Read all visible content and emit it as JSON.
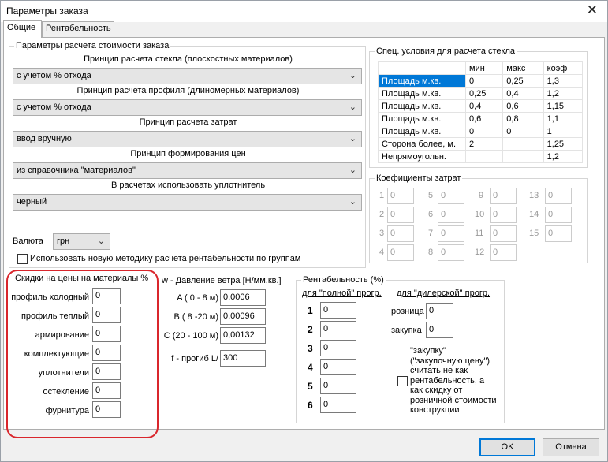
{
  "window": {
    "title": "Параметры заказа",
    "close_glyph": "✕"
  },
  "tabs": [
    {
      "label": "Общие"
    },
    {
      "label": "Рентабельность"
    }
  ],
  "calc": {
    "group_title": "Параметры расчета стоимости заказа",
    "glass_label": "Принцип расчета стекла (плоскостных материалов)",
    "glass_value": "с учетом % отхода",
    "profile_label": "Принцип расчета профиля (длиномерных материалов)",
    "profile_value": "с учетом % отхода",
    "costs_label": "Принцип расчета затрат",
    "costs_value": "ввод вручную",
    "prices_label": "Принцип формирования цен",
    "prices_value": "из справочника \"материалов\"",
    "seal_label": "В расчетах использовать уплотнитель",
    "seal_value": "черный",
    "currency_label": "Валюта",
    "currency_value": "грн",
    "new_method_label": "Использовать новую методику расчета рентабельности по группам",
    "chevron": "⌄"
  },
  "glass_conditions": {
    "title": "Спец. условия для расчета стекла",
    "headers": [
      "",
      "мин",
      "макс",
      "коэф"
    ],
    "rows": [
      [
        "Площадь м.кв.",
        "0",
        "0,25",
        "1,3"
      ],
      [
        "Площадь м.кв.",
        "0,25",
        "0,4",
        "1,2"
      ],
      [
        "Площадь м.кв.",
        "0,4",
        "0,6",
        "1,15"
      ],
      [
        "Площадь м.кв.",
        "0,6",
        "0,8",
        "1,1"
      ],
      [
        "Площадь м.кв.",
        "0",
        "0",
        "1"
      ],
      [
        "Сторона более, м.",
        "2",
        "",
        "1,25"
      ],
      [
        "Непрямоугольн.",
        "",
        "",
        "1,2"
      ]
    ]
  },
  "cost_coefs": {
    "title": "Коефициенты затрат",
    "items": [
      {
        "n": "1",
        "v": "0"
      },
      {
        "n": "2",
        "v": "0"
      },
      {
        "n": "3",
        "v": "0"
      },
      {
        "n": "4",
        "v": "0"
      },
      {
        "n": "5",
        "v": "0"
      },
      {
        "n": "6",
        "v": "0"
      },
      {
        "n": "7",
        "v": "0"
      },
      {
        "n": "8",
        "v": "0"
      },
      {
        "n": "9",
        "v": "0"
      },
      {
        "n": "10",
        "v": "0"
      },
      {
        "n": "11",
        "v": "0"
      },
      {
        "n": "12",
        "v": "0"
      },
      {
        "n": "13",
        "v": "0"
      },
      {
        "n": "14",
        "v": "0"
      },
      {
        "n": "15",
        "v": "0"
      }
    ]
  },
  "discounts": {
    "title": "Скидки на цены на материалы %",
    "items": [
      {
        "label": "профиль холодный",
        "value": "0"
      },
      {
        "label": "профиль теплый",
        "value": "0"
      },
      {
        "label": "армирование",
        "value": "0"
      },
      {
        "label": "комплектующие",
        "value": "0"
      },
      {
        "label": "уплотнители",
        "value": "0"
      },
      {
        "label": "остекление",
        "value": "0"
      },
      {
        "label": "фурнитура",
        "value": "0"
      }
    ]
  },
  "wind": {
    "title": "w - Давление ветра [Н/мм.кв.]",
    "a_label": "A ( 0 - 8 м)",
    "a_value": "0,0006",
    "b_label": "B ( 8 -20 м)",
    "b_value": "0,00096",
    "c_label": "C (20 - 100 м)",
    "c_value": "0,00132",
    "f_label": "f - прогиб  L/",
    "f_value": "300"
  },
  "profitability": {
    "title": "Рентабельность (%)",
    "full_label": "для \"полной\" прогр.",
    "full_items": [
      {
        "n": "1",
        "v": "0"
      },
      {
        "n": "2",
        "v": "0"
      },
      {
        "n": "3",
        "v": "0"
      },
      {
        "n": "4",
        "v": "0"
      },
      {
        "n": "5",
        "v": "0"
      },
      {
        "n": "6",
        "v": "0"
      }
    ],
    "dealer_label": "для \"дилерской\" прогр.",
    "retail_label": "розница",
    "retail_value": "0",
    "purchase_label": "закупка",
    "purchase_value": "0",
    "note_lines": [
      "\"закупку\"",
      "(\"закупочную цену\")",
      "считать не как",
      "рентабельность, а",
      "как скидку от",
      "розничной стоимости",
      "конструкции"
    ]
  },
  "buttons": {
    "ok": "OK",
    "cancel": "Отмена"
  }
}
